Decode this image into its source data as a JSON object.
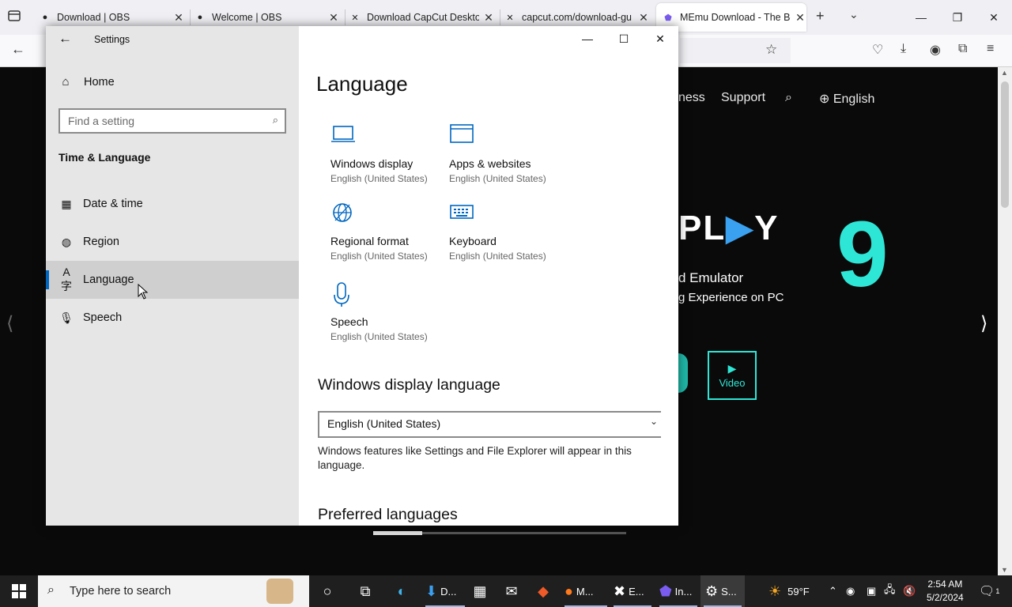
{
  "browser": {
    "tabs": [
      {
        "title": "Download | OBS",
        "active": false
      },
      {
        "title": "Welcome | OBS",
        "active": false
      },
      {
        "title": "Download CapCut Deskto",
        "active": false
      },
      {
        "title": "capcut.com/download-gu",
        "active": false
      },
      {
        "title": "MEmu Download - The Be",
        "active": true
      }
    ]
  },
  "webpage": {
    "nav": {
      "business_partial": "ness",
      "support": "Support",
      "language": "English"
    },
    "logo_partial": "PL",
    "logo_end": "Y",
    "nine": "9",
    "headline_partial": "d Emulator",
    "subheadline_partial": "g Experience on PC",
    "video_label": "Video"
  },
  "settings": {
    "window_title": "Settings",
    "home": "Home",
    "search_placeholder": "Find a setting",
    "section": "Time & Language",
    "nav_items": [
      {
        "label": "Date & time",
        "selected": false
      },
      {
        "label": "Region",
        "selected": false
      },
      {
        "label": "Language",
        "selected": true
      },
      {
        "label": "Speech",
        "selected": false
      }
    ],
    "page_heading": "Language",
    "tiles": [
      {
        "name": "Windows display",
        "sub": "English (United States)"
      },
      {
        "name": "Apps & websites",
        "sub": "English (United States)"
      },
      {
        "name": "Regional format",
        "sub": "English (United States)"
      },
      {
        "name": "Keyboard",
        "sub": "English (United States)"
      },
      {
        "name": "Speech",
        "sub": "English (United States)"
      }
    ],
    "display_language_heading": "Windows display language",
    "display_language_value": "English (United States)",
    "display_language_desc": "Windows features like Settings and File Explorer will appear in this language.",
    "preferred_heading": "Preferred languages"
  },
  "taskbar": {
    "search_placeholder": "Type here to search",
    "apps": [
      {
        "label": "D..."
      },
      {
        "label": "M..."
      },
      {
        "label": "E..."
      },
      {
        "label": "In..."
      },
      {
        "label": "S..."
      }
    ],
    "weather": "59°F",
    "time": "2:54 AM",
    "date": "5/2/2024",
    "notification_count": "1"
  }
}
